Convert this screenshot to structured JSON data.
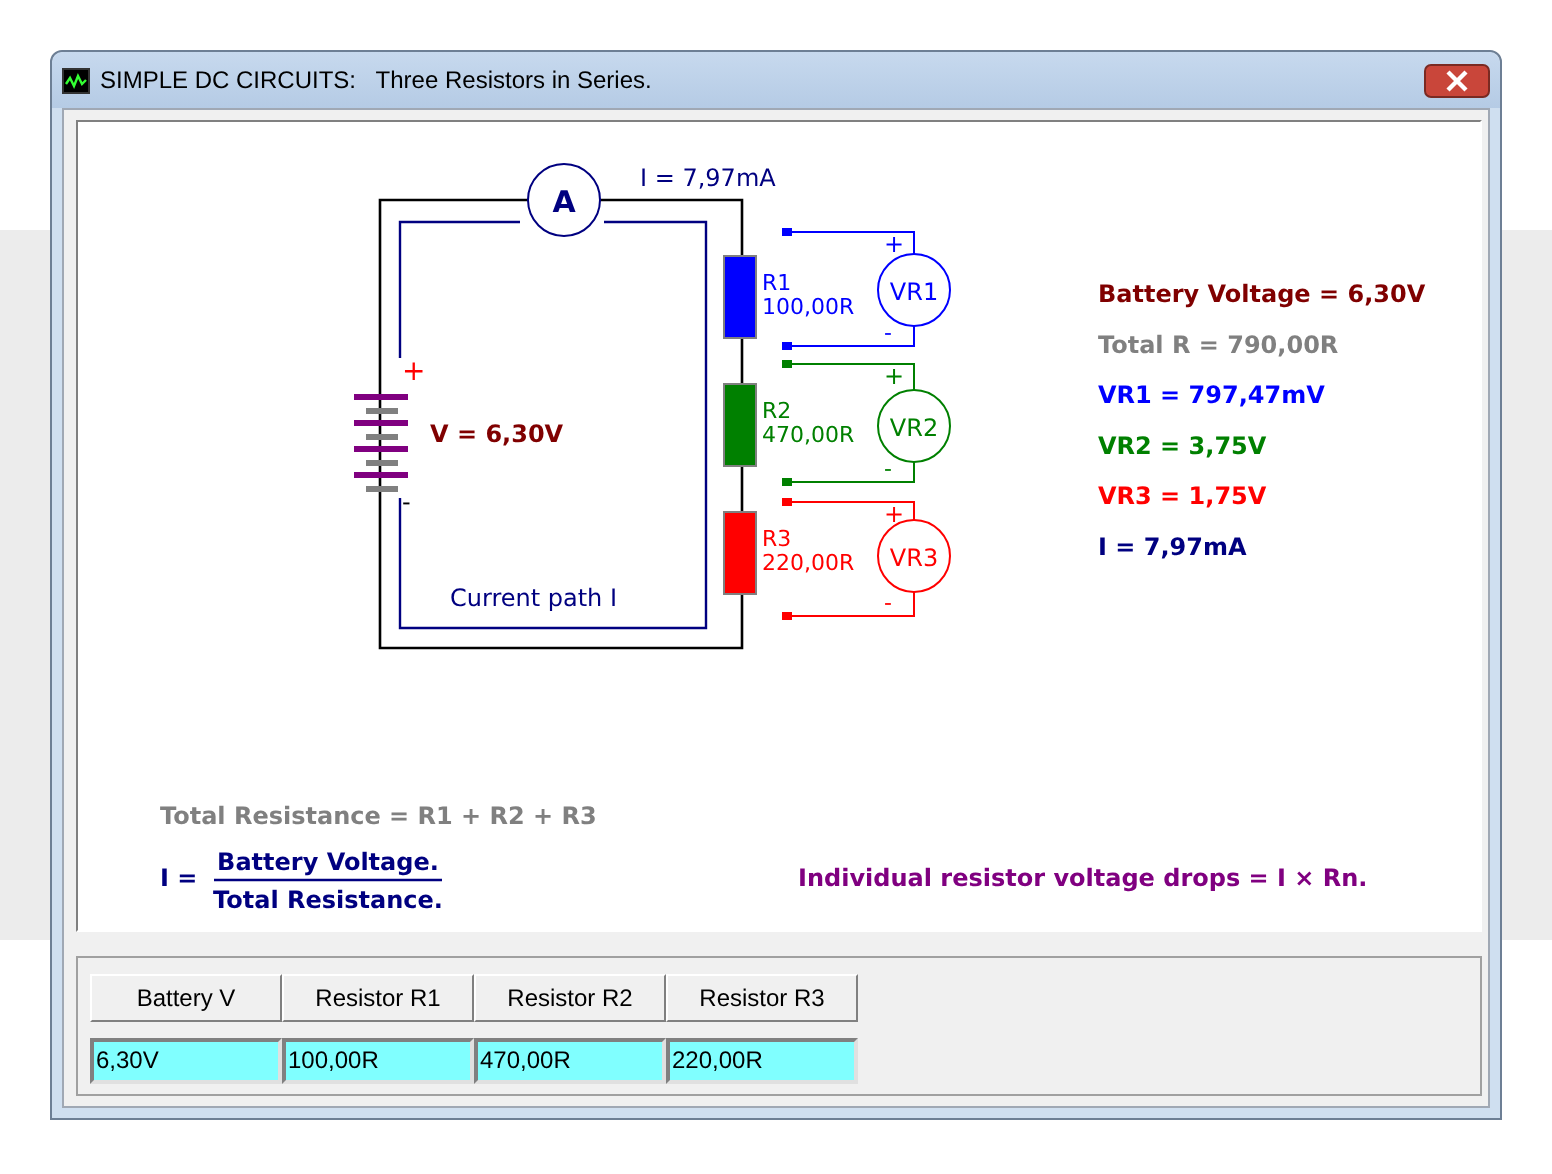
{
  "window": {
    "title": "SIMPLE DC CIRCUITS:   Three Resistors in Series."
  },
  "circuit": {
    "current_reading": "I = 7,97mA",
    "ammeter_label": "A",
    "battery": {
      "plus": "+",
      "minus": "-",
      "label": "V = 6,30V"
    },
    "resistors": [
      {
        "name": "R1",
        "value": "100,00R",
        "color": "#0000ff"
      },
      {
        "name": "R2",
        "value": "470,00R",
        "color": "#008000"
      },
      {
        "name": "R3",
        "value": "220,00R",
        "color": "#ff0000"
      }
    ],
    "voltmeters": [
      {
        "label": "VR1",
        "plus": "+",
        "minus": "-",
        "color": "#0000ff"
      },
      {
        "label": "VR2",
        "plus": "+",
        "minus": "-",
        "color": "#008000"
      },
      {
        "label": "VR3",
        "plus": "+",
        "minus": "-",
        "color": "#ff0000"
      }
    ],
    "path_label": "Current path I"
  },
  "results": [
    {
      "text": "Battery Voltage = 6,30V",
      "color": "#800000"
    },
    {
      "text": "Total R = 790,00R",
      "color": "#808080"
    },
    {
      "text": "VR1 = 797,47mV",
      "color": "#0000ff"
    },
    {
      "text": "VR2 = 3,75V",
      "color": "#008000"
    },
    {
      "text": "VR3 = 1,75V",
      "color": "#ff0000"
    },
    {
      "text": "I = 7,97mA",
      "color": "#000080"
    }
  ],
  "formulas": {
    "total_resistance": "Total Resistance = R1 + R2 + R3",
    "current_prefix": "I =",
    "numerator": "Battery Voltage.",
    "denominator": "Total Resistance.",
    "drops": "Individual resistor voltage drops = I × Rn."
  },
  "table": {
    "columns": [
      "Battery V",
      "Resistor R1",
      "Resistor R2",
      "Resistor R3"
    ],
    "rows": [
      [
        "6,30V",
        "100,00R",
        "470,00R",
        "220,00R"
      ]
    ]
  }
}
